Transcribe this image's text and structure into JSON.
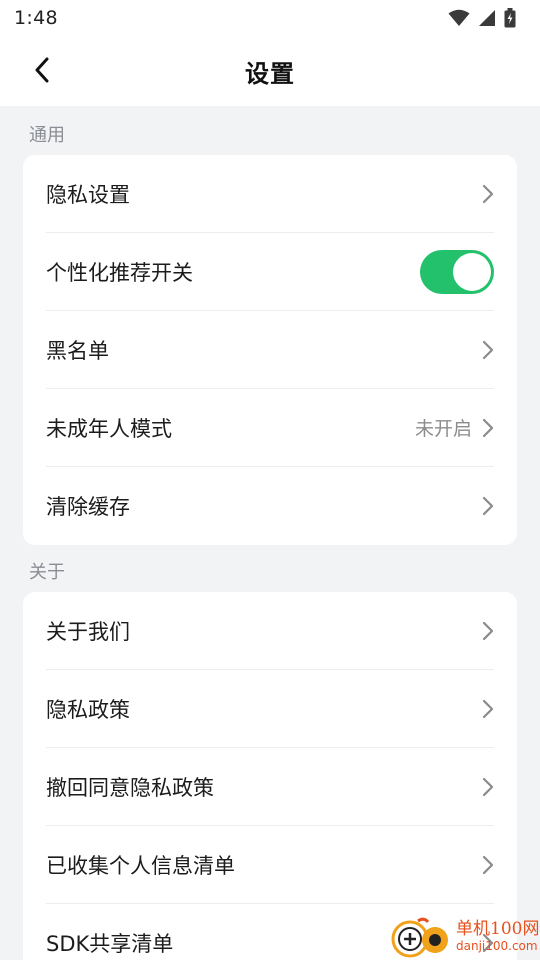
{
  "status_bar": {
    "time": "1:48"
  },
  "header": {
    "title": "设置"
  },
  "sections": [
    {
      "label": "通用",
      "items": [
        {
          "label": "隐私设置"
        },
        {
          "label": "个性化推荐开关",
          "toggle_on": true
        },
        {
          "label": "黑名单"
        },
        {
          "label": "未成年人模式",
          "value": "未开启"
        },
        {
          "label": "清除缓存"
        }
      ]
    },
    {
      "label": "关于",
      "items": [
        {
          "label": "关于我们"
        },
        {
          "label": "隐私政策"
        },
        {
          "label": "撤回同意隐私政策"
        },
        {
          "label": "已收集个人信息清单"
        },
        {
          "label": "SDK共享清单"
        }
      ]
    }
  ],
  "watermark": {
    "main": "单机100网",
    "sub": "danji100.com"
  },
  "colors": {
    "toggle_on": "#23c16b",
    "background": "#f2f3f5",
    "watermark": "#e8501e"
  },
  "icons": {
    "back": "chevron-left-icon",
    "row_arrow": "chevron-right-icon",
    "wifi": "wifi-icon",
    "signal": "signal-icon",
    "battery": "battery-charging-icon"
  }
}
